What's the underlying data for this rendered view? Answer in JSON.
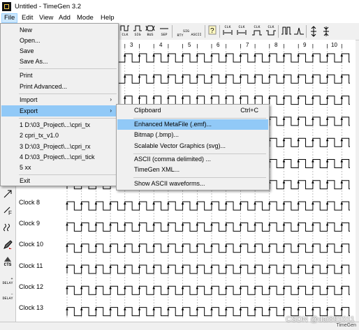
{
  "window": {
    "title": "Untitled - TimeGen 3.2"
  },
  "menubar": {
    "items": [
      "File",
      "Edit",
      "View",
      "Add",
      "Mode",
      "Help"
    ]
  },
  "toolbar": {
    "labels": [
      "CLK",
      "SIG",
      "BUS",
      "SEP",
      "SIG\nRTY",
      "ASCII",
      "CLK",
      "CLK",
      "CLK",
      "CLK"
    ]
  },
  "left_toolbar": {
    "labels": [
      "CTS",
      "+\nDELAY",
      "−\nDELAY"
    ]
  },
  "diagram": {
    "ruler_ticks": [
      "3",
      "4",
      "5",
      "6",
      "7",
      "8",
      "9",
      "10"
    ],
    "signals": [
      "Clock 8",
      "Clock 9",
      "Clock 10",
      "Clock 11",
      "Clock 12",
      "Clock 13"
    ]
  },
  "file_menu": {
    "items": [
      {
        "label": "New"
      },
      {
        "label": "Open..."
      },
      {
        "label": "Save"
      },
      {
        "label": "Save As..."
      },
      {
        "label": "Print"
      },
      {
        "label": "Print Advanced..."
      },
      {
        "label": "Import",
        "submenu": true
      },
      {
        "label": "Export",
        "submenu": true,
        "highlighted": true
      },
      {
        "label": "1 D:\\03_Project\\...\\cpri_tx"
      },
      {
        "label": "2 cpri_tx_v1.0"
      },
      {
        "label": "3 D:\\03_Project\\...\\cpri_rx"
      },
      {
        "label": "4 D:\\03_Project\\...\\cpri_tick"
      },
      {
        "label": "5 xx"
      },
      {
        "label": "Exit"
      }
    ]
  },
  "export_menu": {
    "items": [
      {
        "label": "Clipboard",
        "shortcut": "Ctrl+C"
      },
      {
        "label": "Enhanced MetaFile (.emf)...",
        "highlighted": true
      },
      {
        "label": "Bitmap (.bmp)..."
      },
      {
        "label": "Scalable Vector Graphics  (svg)..."
      },
      {
        "label": "ASCII (comma delimited) ..."
      },
      {
        "label": "TimeGen XML..."
      },
      {
        "label": "Show ASCII waveforms..."
      }
    ]
  },
  "statusbar": {
    "text": "TimeGen"
  },
  "watermark": "CSDN @dai891011",
  "colors": {
    "highlight": "#91c9f7",
    "menu_bg": "#f0f0f0"
  }
}
